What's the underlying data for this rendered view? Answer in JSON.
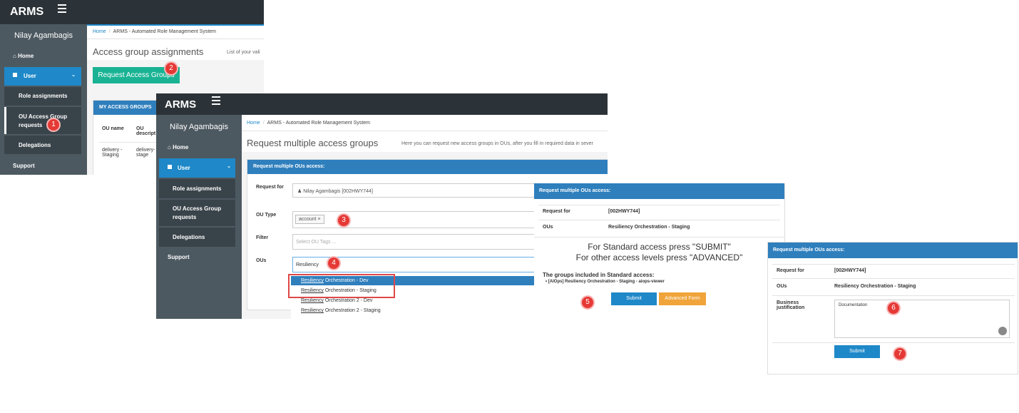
{
  "app": {
    "logo": "ARMS",
    "user_name": "Nilay Agambagis"
  },
  "nav": {
    "home": "Home",
    "user": "User",
    "role_assignments": "Role assignments",
    "ou_requests_line1": "OU Access Group",
    "ou_requests_line2": "requests",
    "delegations": "Delegations",
    "support": "Support"
  },
  "breadcrumb": {
    "home": "Home",
    "current": "ARMS - Automated Role Management System"
  },
  "screen1": {
    "title": "Access group assignments",
    "subtext": "List of your vali",
    "request_button": "Request Access Groups",
    "panel_title": "MY ACCESS GROUPS",
    "col_ou_name": "OU name",
    "col_ou_desc_1": "OU",
    "col_ou_desc_2": "descript",
    "row_ou_name_1": "delivery -",
    "row_ou_name_2": "Staging",
    "row_desc_1": "delivery-",
    "row_desc_2": "stage"
  },
  "screen2": {
    "title": "Request multiple access groups",
    "subtext": "Here you can request new access groups in OUs, after you fill in required data in sever",
    "panel_title": "Request multiple OUs access:",
    "request_for_label": "Request for",
    "request_for_value": "Nilay Agambagis [002HWY744]",
    "ou_type_label": "OU Type",
    "ou_type_tag": "account",
    "filter_label": "Filter",
    "filter_placeholder": "Select OU Tags ...",
    "ous_label": "OUs",
    "ous_value": "Resiliency",
    "options": [
      {
        "match": "Resiliency",
        "rest": " Orchestration - Dev"
      },
      {
        "match": "Resiliency",
        "rest": " Orchestration - Staging"
      },
      {
        "match": "Resiliency",
        "rest": " Orchestration 2 - Dev"
      },
      {
        "match": "Resiliency",
        "rest": " Orchestration 2 - Staging"
      }
    ]
  },
  "screen3": {
    "panel_title": "Request multiple OUs access:",
    "request_for_label": "Request for",
    "request_for_value": "[002HWY744]",
    "ous_label": "OUs",
    "ous_value": "Resiliency Orchestration - Staging",
    "line1": "For Standard access press \"SUBMIT\"",
    "line2": "For other access levels press \"ADVANCED\"",
    "groups_heading": "The groups included in Standard access:",
    "group_item": "[AIOps] Resiliency Orchestration - Staging - aiops-viewer",
    "submit": "Submit",
    "advanced": "Advanced Form"
  },
  "screen4": {
    "panel_title": "Request multiple OUs access:",
    "request_for_label": "Request for",
    "request_for_value": "[002HWY744]",
    "ous_label": "OUs",
    "ous_value": "Resiliency Orchestration - Staging",
    "justification_label_1": "Business",
    "justification_label_2": "justification",
    "justification_value": "Documentation",
    "submit": "Submit"
  },
  "steps": [
    "1",
    "2",
    "3",
    "4",
    "5",
    "6",
    "7"
  ],
  "colors": {
    "topbar": "#2c3338",
    "sidebar": "#4d5961",
    "accent": "#1e88c8",
    "green": "#19b394",
    "orange": "#f0a43a",
    "badge": "#e53935"
  }
}
